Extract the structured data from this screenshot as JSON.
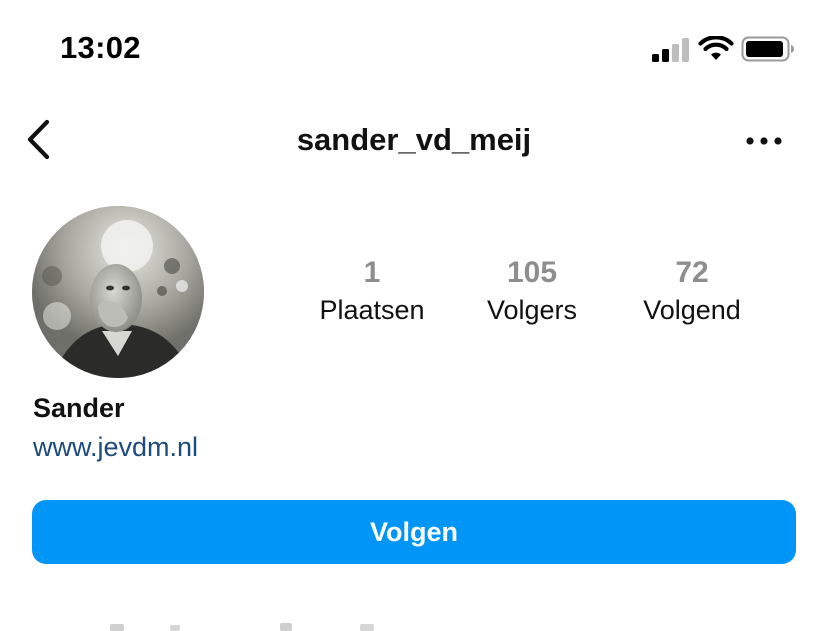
{
  "status_bar": {
    "time": "13:02",
    "icons": [
      "signal-icon",
      "wifi-icon",
      "battery-icon"
    ]
  },
  "header": {
    "title": "sander_vd_meij",
    "back_icon": "chevron-left-icon",
    "more_icon": "more-horizontal-icon"
  },
  "profile": {
    "avatar": "avatar-photo",
    "name": "Sander",
    "website": "www.jevdm.nl",
    "stats": [
      {
        "count": "1",
        "label": "Plaatsen"
      },
      {
        "count": "105",
        "label": "Volgers"
      },
      {
        "count": "72",
        "label": "Volgend"
      }
    ]
  },
  "actions": {
    "follow_label": "Volgen"
  },
  "colors": {
    "accent": "#0095f6",
    "link": "#1c4a7a",
    "count_gray": "#8e8e8e",
    "text": "#111111"
  }
}
